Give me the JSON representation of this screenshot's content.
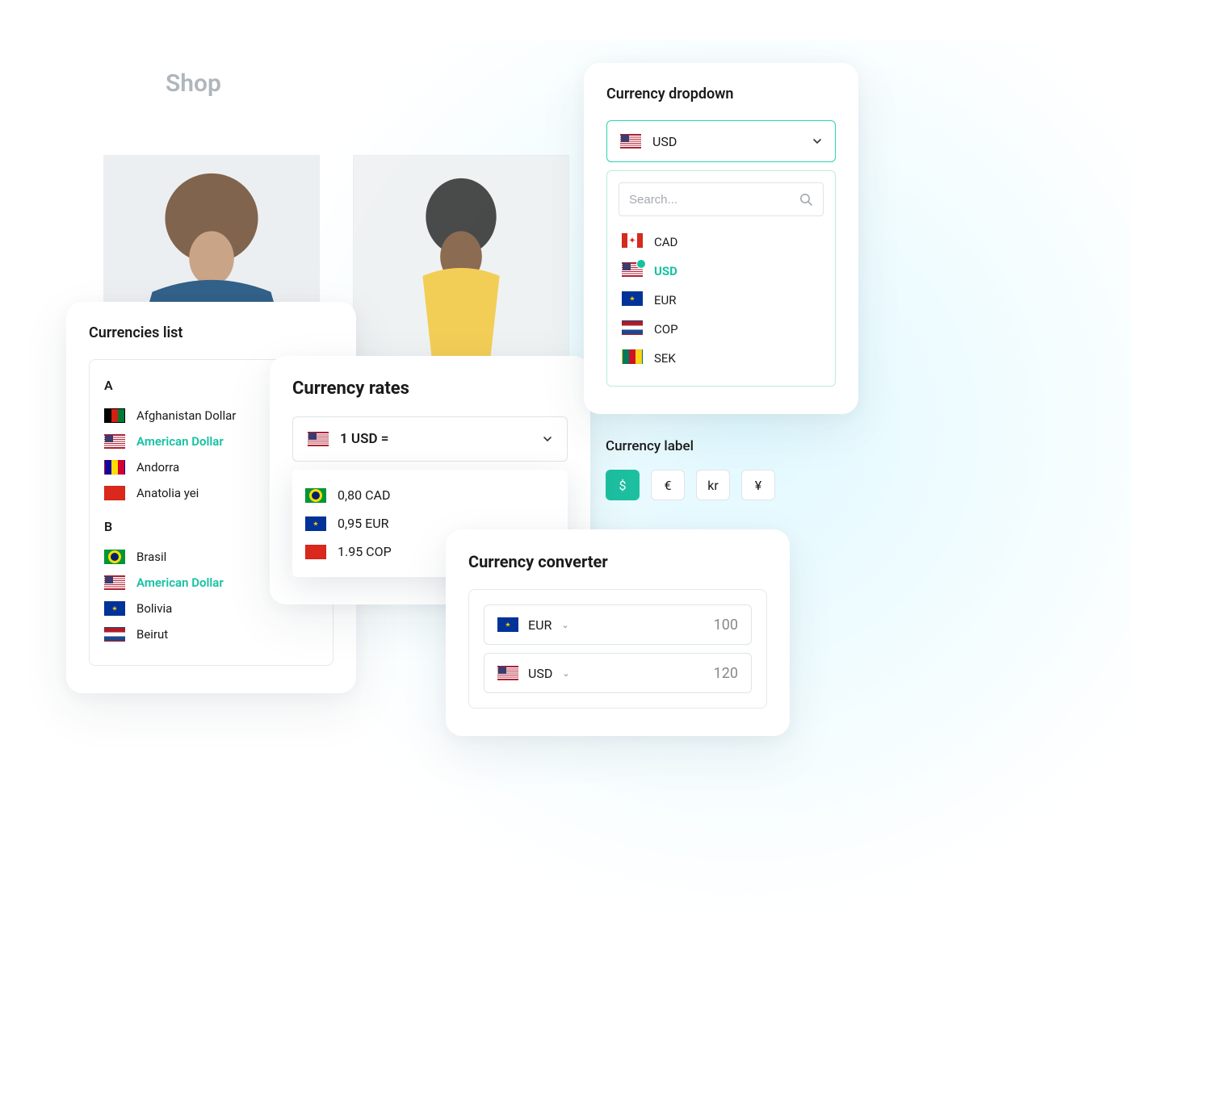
{
  "shop_label": "Shop",
  "currencies_list": {
    "title": "Currencies list",
    "groups": [
      {
        "letter": "A",
        "items": [
          {
            "flag": "af",
            "name": "Afghanistan Dollar",
            "selected": false
          },
          {
            "flag": "us",
            "name": "American Dollar",
            "selected": true
          },
          {
            "flag": "ad",
            "name": "Andorra",
            "selected": false
          },
          {
            "flag": "al",
            "name": "Anatolia yei",
            "selected": false
          }
        ]
      },
      {
        "letter": "B",
        "items": [
          {
            "flag": "br",
            "name": "Brasil",
            "selected": false
          },
          {
            "flag": "us",
            "name": "American Dollar",
            "selected": true
          },
          {
            "flag": "eu",
            "name": "Bolivia",
            "selected": false
          },
          {
            "flag": "nl",
            "name": "Beirut",
            "selected": false
          }
        ]
      }
    ]
  },
  "currency_rates": {
    "title": "Currency rates",
    "base_label": "1 USD =",
    "base_flag": "us",
    "rates": [
      {
        "flag": "br",
        "text": "0,80 CAD"
      },
      {
        "flag": "eu",
        "text": "0,95 EUR"
      },
      {
        "flag": "al",
        "text": "1.95 COP"
      }
    ]
  },
  "currency_dropdown": {
    "title": "Currency dropdown",
    "selected_flag": "us",
    "selected_code": "USD",
    "search_placeholder": "Search...",
    "options": [
      {
        "flag": "ca",
        "code": "CAD",
        "selected": false
      },
      {
        "flag": "us",
        "code": "USD",
        "selected": true
      },
      {
        "flag": "eu",
        "code": "EUR",
        "selected": false
      },
      {
        "flag": "nl",
        "code": "COP",
        "selected": false
      },
      {
        "flag": "cm",
        "code": "SEK",
        "selected": false
      }
    ]
  },
  "currency_label": {
    "title": "Currency label",
    "labels": [
      {
        "symbol": "$",
        "active": true
      },
      {
        "symbol": "€",
        "active": false
      },
      {
        "symbol": "kr",
        "active": false
      },
      {
        "symbol": "¥",
        "active": false
      }
    ]
  },
  "currency_converter": {
    "title": "Currency converter",
    "rows": [
      {
        "flag": "eu",
        "code": "EUR",
        "value": "100"
      },
      {
        "flag": "us",
        "code": "USD",
        "value": "120"
      }
    ]
  }
}
